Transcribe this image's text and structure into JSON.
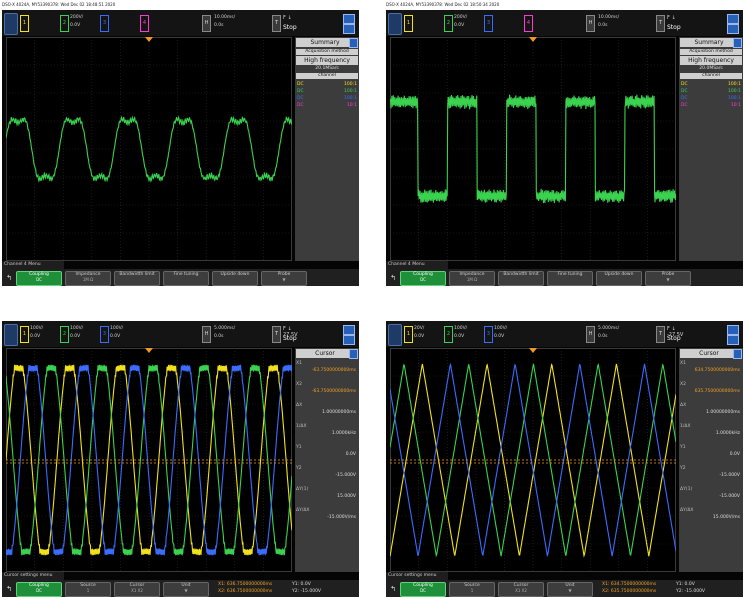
{
  "panels": [
    {
      "header": "DSO-X 4024A, MY53390378: Wed Dec 02 18:48:51 2020",
      "channels": [
        {
          "num": "1",
          "line1": "",
          "line2": "",
          "color": "#f2e21e"
        },
        {
          "num": "2",
          "line1": "200V/",
          "line2": "0.0V",
          "color": "#3ad24e"
        },
        {
          "num": "3",
          "line1": "",
          "line2": "",
          "color": "#3a6cff"
        },
        {
          "num": "4",
          "line1": "",
          "line2": "",
          "color": "#ff3ad9"
        }
      ],
      "timebase": {
        "line1": "10.00ms/",
        "line2": "0.0s"
      },
      "trigger": {
        "symbol": "T",
        "state1": "F ↓",
        "state2": "Stop"
      },
      "side": {
        "title": "Summary",
        "rows": [
          "Acquisition method"
        ],
        "box": "High frequency",
        "rows2": [
          "20.1MSa/s",
          "channel"
        ],
        "chrows": [
          {
            "ch": "DC",
            "val": "100:1",
            "color": "#f2e21e"
          },
          {
            "ch": "DC",
            "val": "100:1",
            "color": "#3ad24e"
          },
          {
            "ch": "DC",
            "val": "100:1",
            "color": "#3a6cff"
          },
          {
            "ch": "DC",
            "val": "10:1",
            "color": "#ff3ad9"
          }
        ]
      },
      "menu_label": "Channel 4 Menu",
      "softkeys": [
        {
          "label": "Coupling",
          "value": "DC",
          "green": true
        },
        {
          "label": "Impedance",
          "value": "1M Ω",
          "green": false
        },
        {
          "label": "Bandwidth limit",
          "value": "",
          "green": false
        },
        {
          "label": "Fine tuning",
          "value": "",
          "green": false
        },
        {
          "label": "Upside down",
          "value": "",
          "green": false
        },
        {
          "label": "Probe",
          "value": "▼",
          "green": false
        }
      ]
    },
    {
      "header": "DSO-X 4024A, MY53390378: Wed Dec 02 18:50:34 2020",
      "channels": [
        {
          "num": "1",
          "line1": "",
          "line2": "",
          "color": "#f2e21e"
        },
        {
          "num": "2",
          "line1": "200V/",
          "line2": "0.0V",
          "color": "#3ad24e"
        },
        {
          "num": "3",
          "line1": "",
          "line2": "",
          "color": "#3a6cff"
        },
        {
          "num": "4",
          "line1": "",
          "line2": "",
          "color": "#ff3ad9"
        }
      ],
      "timebase": {
        "line1": "10.00ms/",
        "line2": "0.0s"
      },
      "trigger": {
        "symbol": "T",
        "state1": "F ↓",
        "state2": "Stop"
      },
      "side": {
        "title": "Summary",
        "rows": [
          "Acquisition method"
        ],
        "box": "High frequency",
        "rows2": [
          "20.0MSa/s",
          "channel"
        ],
        "chrows": [
          {
            "ch": "DC",
            "val": "100:1",
            "color": "#f2e21e"
          },
          {
            "ch": "DC",
            "val": "100:1",
            "color": "#3ad24e"
          },
          {
            "ch": "DC",
            "val": "100:1",
            "color": "#3a6cff"
          },
          {
            "ch": "DC",
            "val": "10:1",
            "color": "#ff3ad9"
          }
        ]
      },
      "menu_label": "Channel 4 Menu",
      "softkeys": [
        {
          "label": "Coupling",
          "value": "DC",
          "green": true
        },
        {
          "label": "Impedance",
          "value": "1M Ω",
          "green": false
        },
        {
          "label": "Bandwidth limit",
          "value": "",
          "green": false
        },
        {
          "label": "Fine tuning",
          "value": "",
          "green": false
        },
        {
          "label": "Upside down",
          "value": "",
          "green": false
        },
        {
          "label": "Probe",
          "value": "▼",
          "green": false
        }
      ]
    },
    {
      "header": "",
      "channels": [
        {
          "num": "1",
          "line1": "100V/",
          "line2": "0.0V",
          "color": "#f2e21e"
        },
        {
          "num": "2",
          "line1": "100V/",
          "line2": "0.0V",
          "color": "#3ad24e"
        },
        {
          "num": "3",
          "line1": "100V/",
          "line2": "0.0V",
          "color": "#3a6cff"
        }
      ],
      "timebase": {
        "line1": "5.000ms/",
        "line2": "0.0s"
      },
      "trigger": {
        "symbol": "T",
        "state1": "F ↓  27.5V",
        "state2": "Stop"
      },
      "side": {
        "title": "Cursor",
        "cursor_rows": [
          {
            "label": "X1",
            "val": "-63.7500000000ms",
            "color": "#f2a020"
          },
          {
            "label": "X2",
            "val": "-63.7500000000ms",
            "color": "#f2a020"
          },
          {
            "label": "ΔX",
            "val": "1.00000000ms",
            "color": "#ddd"
          },
          {
            "label": "1/ΔX",
            "val": "1.0000kHz",
            "color": "#ddd"
          },
          {
            "label": "Y1",
            "val": "0.0V",
            "color": "#ddd"
          },
          {
            "label": "Y2",
            "val": "-15.000V",
            "color": "#ddd"
          },
          {
            "label": "ΔY(1)",
            "val": "15.000V",
            "color": "#ddd"
          },
          {
            "label": "ΔY/ΔX",
            "val": "-15.000V/ms",
            "color": "#ddd"
          }
        ]
      },
      "menu_label": "Cursor settings menu",
      "softkeys": [
        {
          "label": "Coupling",
          "value": "DC",
          "green": true
        },
        {
          "label": "Source",
          "value": "1",
          "green": false
        },
        {
          "label": "Cursor",
          "value": "X1 X2",
          "green": false
        },
        {
          "label": "Unit",
          "value": "▼",
          "green": false
        }
      ],
      "cursor_readout": [
        {
          "text": "X1: 636.7500000000ms",
          "color": "#f2a020"
        },
        {
          "text": "X2: 636.7500000000ms",
          "color": "#f2a020"
        },
        {
          "text": "Y1: 0.0V",
          "color": "#ddd"
        },
        {
          "text": "Y2: -15.000V",
          "color": "#ddd"
        }
      ]
    },
    {
      "header": "",
      "channels": [
        {
          "num": "1",
          "line1": "20V/",
          "line2": "0.0V",
          "color": "#f2e21e"
        },
        {
          "num": "2",
          "line1": "100V/",
          "line2": "0.0V",
          "color": "#3ad24e"
        },
        {
          "num": "3",
          "line1": "100V/",
          "line2": "0.0V",
          "color": "#3a6cff"
        }
      ],
      "timebase": {
        "line1": "5.000ms/",
        "line2": "0.0s"
      },
      "trigger": {
        "symbol": "T",
        "state1": "F ↓  -27.5V",
        "state2": "Stop"
      },
      "side": {
        "title": "Cursor",
        "cursor_rows": [
          {
            "label": "X1",
            "val": "634.7500000000ms",
            "color": "#f2a020"
          },
          {
            "label": "X2",
            "val": "635.7500000000ms",
            "color": "#f2a020"
          },
          {
            "label": "ΔX",
            "val": "1.00000000ms",
            "color": "#ddd"
          },
          {
            "label": "1/ΔX",
            "val": "1.0000kHz",
            "color": "#ddd"
          },
          {
            "label": "Y1",
            "val": "0.0V",
            "color": "#ddd"
          },
          {
            "label": "Y2",
            "val": "-15.000V",
            "color": "#ddd"
          },
          {
            "label": "ΔY(1)",
            "val": "-15.000V",
            "color": "#ddd"
          },
          {
            "label": "ΔY/ΔX",
            "val": "15.000V/ms",
            "color": "#ddd"
          }
        ]
      },
      "menu_label": "Cursor settings menu",
      "softkeys": [
        {
          "label": "Coupling",
          "value": "DC",
          "green": true
        },
        {
          "label": "Source",
          "value": "1",
          "green": false
        },
        {
          "label": "Cursor",
          "value": "X1 X2",
          "green": false
        },
        {
          "label": "Unit",
          "value": "▼",
          "green": false
        }
      ],
      "cursor_readout": [
        {
          "text": "X1: 634.7500000000ms",
          "color": "#f2a020"
        },
        {
          "text": "X2: 635.7500000000ms",
          "color": "#f2a020"
        },
        {
          "text": "Y1: 0.0V",
          "color": "#ddd"
        },
        {
          "text": "Y2: -15.000V",
          "color": "#ddd"
        }
      ]
    }
  ]
}
